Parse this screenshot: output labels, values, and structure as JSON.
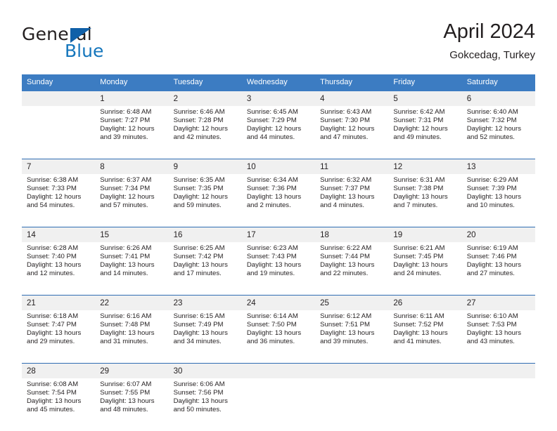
{
  "brand": {
    "name_top": "General",
    "name_bottom": "Blue",
    "accent_color": "#1576bc",
    "triangle_color": "#1060a8"
  },
  "header": {
    "title": "April 2024",
    "subtitle": "Gokcedag, Turkey"
  },
  "theme": {
    "header_bg": "#3c7cc2",
    "header_text": "#ffffff",
    "daynum_bg": "#f0f0f0",
    "rule_color": "#2e6cb3",
    "text_color": "#231f20"
  },
  "weekday_headers": [
    "Sunday",
    "Monday",
    "Tuesday",
    "Wednesday",
    "Thursday",
    "Friday",
    "Saturday"
  ],
  "weeks": [
    {
      "days": [
        {
          "num": "",
          "l1": "",
          "l2": "",
          "l3": "",
          "l4": ""
        },
        {
          "num": "1",
          "l1": "Sunrise: 6:48 AM",
          "l2": "Sunset: 7:27 PM",
          "l3": "Daylight: 12 hours",
          "l4": "and 39 minutes."
        },
        {
          "num": "2",
          "l1": "Sunrise: 6:46 AM",
          "l2": "Sunset: 7:28 PM",
          "l3": "Daylight: 12 hours",
          "l4": "and 42 minutes."
        },
        {
          "num": "3",
          "l1": "Sunrise: 6:45 AM",
          "l2": "Sunset: 7:29 PM",
          "l3": "Daylight: 12 hours",
          "l4": "and 44 minutes."
        },
        {
          "num": "4",
          "l1": "Sunrise: 6:43 AM",
          "l2": "Sunset: 7:30 PM",
          "l3": "Daylight: 12 hours",
          "l4": "and 47 minutes."
        },
        {
          "num": "5",
          "l1": "Sunrise: 6:42 AM",
          "l2": "Sunset: 7:31 PM",
          "l3": "Daylight: 12 hours",
          "l4": "and 49 minutes."
        },
        {
          "num": "6",
          "l1": "Sunrise: 6:40 AM",
          "l2": "Sunset: 7:32 PM",
          "l3": "Daylight: 12 hours",
          "l4": "and 52 minutes."
        }
      ]
    },
    {
      "days": [
        {
          "num": "7",
          "l1": "Sunrise: 6:38 AM",
          "l2": "Sunset: 7:33 PM",
          "l3": "Daylight: 12 hours",
          "l4": "and 54 minutes."
        },
        {
          "num": "8",
          "l1": "Sunrise: 6:37 AM",
          "l2": "Sunset: 7:34 PM",
          "l3": "Daylight: 12 hours",
          "l4": "and 57 minutes."
        },
        {
          "num": "9",
          "l1": "Sunrise: 6:35 AM",
          "l2": "Sunset: 7:35 PM",
          "l3": "Daylight: 12 hours",
          "l4": "and 59 minutes."
        },
        {
          "num": "10",
          "l1": "Sunrise: 6:34 AM",
          "l2": "Sunset: 7:36 PM",
          "l3": "Daylight: 13 hours",
          "l4": "and 2 minutes."
        },
        {
          "num": "11",
          "l1": "Sunrise: 6:32 AM",
          "l2": "Sunset: 7:37 PM",
          "l3": "Daylight: 13 hours",
          "l4": "and 4 minutes."
        },
        {
          "num": "12",
          "l1": "Sunrise: 6:31 AM",
          "l2": "Sunset: 7:38 PM",
          "l3": "Daylight: 13 hours",
          "l4": "and 7 minutes."
        },
        {
          "num": "13",
          "l1": "Sunrise: 6:29 AM",
          "l2": "Sunset: 7:39 PM",
          "l3": "Daylight: 13 hours",
          "l4": "and 10 minutes."
        }
      ]
    },
    {
      "days": [
        {
          "num": "14",
          "l1": "Sunrise: 6:28 AM",
          "l2": "Sunset: 7:40 PM",
          "l3": "Daylight: 13 hours",
          "l4": "and 12 minutes."
        },
        {
          "num": "15",
          "l1": "Sunrise: 6:26 AM",
          "l2": "Sunset: 7:41 PM",
          "l3": "Daylight: 13 hours",
          "l4": "and 14 minutes."
        },
        {
          "num": "16",
          "l1": "Sunrise: 6:25 AM",
          "l2": "Sunset: 7:42 PM",
          "l3": "Daylight: 13 hours",
          "l4": "and 17 minutes."
        },
        {
          "num": "17",
          "l1": "Sunrise: 6:23 AM",
          "l2": "Sunset: 7:43 PM",
          "l3": "Daylight: 13 hours",
          "l4": "and 19 minutes."
        },
        {
          "num": "18",
          "l1": "Sunrise: 6:22 AM",
          "l2": "Sunset: 7:44 PM",
          "l3": "Daylight: 13 hours",
          "l4": "and 22 minutes."
        },
        {
          "num": "19",
          "l1": "Sunrise: 6:21 AM",
          "l2": "Sunset: 7:45 PM",
          "l3": "Daylight: 13 hours",
          "l4": "and 24 minutes."
        },
        {
          "num": "20",
          "l1": "Sunrise: 6:19 AM",
          "l2": "Sunset: 7:46 PM",
          "l3": "Daylight: 13 hours",
          "l4": "and 27 minutes."
        }
      ]
    },
    {
      "days": [
        {
          "num": "21",
          "l1": "Sunrise: 6:18 AM",
          "l2": "Sunset: 7:47 PM",
          "l3": "Daylight: 13 hours",
          "l4": "and 29 minutes."
        },
        {
          "num": "22",
          "l1": "Sunrise: 6:16 AM",
          "l2": "Sunset: 7:48 PM",
          "l3": "Daylight: 13 hours",
          "l4": "and 31 minutes."
        },
        {
          "num": "23",
          "l1": "Sunrise: 6:15 AM",
          "l2": "Sunset: 7:49 PM",
          "l3": "Daylight: 13 hours",
          "l4": "and 34 minutes."
        },
        {
          "num": "24",
          "l1": "Sunrise: 6:14 AM",
          "l2": "Sunset: 7:50 PM",
          "l3": "Daylight: 13 hours",
          "l4": "and 36 minutes."
        },
        {
          "num": "25",
          "l1": "Sunrise: 6:12 AM",
          "l2": "Sunset: 7:51 PM",
          "l3": "Daylight: 13 hours",
          "l4": "and 39 minutes."
        },
        {
          "num": "26",
          "l1": "Sunrise: 6:11 AM",
          "l2": "Sunset: 7:52 PM",
          "l3": "Daylight: 13 hours",
          "l4": "and 41 minutes."
        },
        {
          "num": "27",
          "l1": "Sunrise: 6:10 AM",
          "l2": "Sunset: 7:53 PM",
          "l3": "Daylight: 13 hours",
          "l4": "and 43 minutes."
        }
      ]
    },
    {
      "days": [
        {
          "num": "28",
          "l1": "Sunrise: 6:08 AM",
          "l2": "Sunset: 7:54 PM",
          "l3": "Daylight: 13 hours",
          "l4": "and 45 minutes."
        },
        {
          "num": "29",
          "l1": "Sunrise: 6:07 AM",
          "l2": "Sunset: 7:55 PM",
          "l3": "Daylight: 13 hours",
          "l4": "and 48 minutes."
        },
        {
          "num": "30",
          "l1": "Sunrise: 6:06 AM",
          "l2": "Sunset: 7:56 PM",
          "l3": "Daylight: 13 hours",
          "l4": "and 50 minutes."
        },
        {
          "num": "",
          "l1": "",
          "l2": "",
          "l3": "",
          "l4": ""
        },
        {
          "num": "",
          "l1": "",
          "l2": "",
          "l3": "",
          "l4": ""
        },
        {
          "num": "",
          "l1": "",
          "l2": "",
          "l3": "",
          "l4": ""
        },
        {
          "num": "",
          "l1": "",
          "l2": "",
          "l3": "",
          "l4": ""
        }
      ]
    }
  ]
}
